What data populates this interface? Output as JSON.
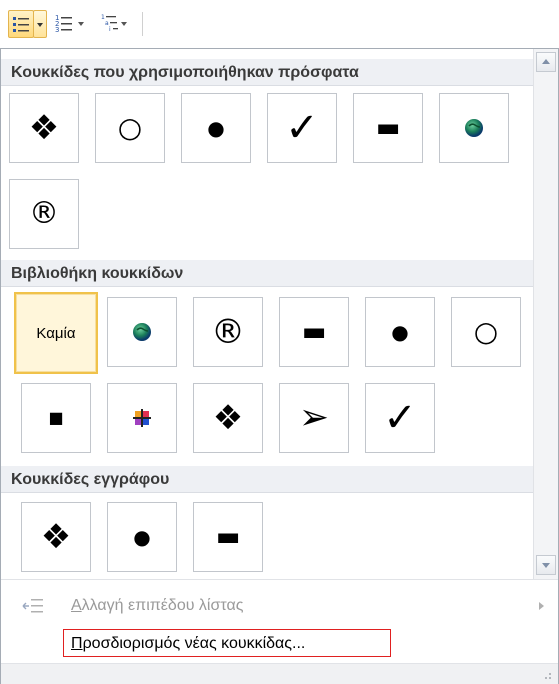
{
  "toolbar": {
    "bullets_icon": "bullet-list-icon",
    "numbering_icon": "numbered-list-icon",
    "multilevel_icon": "multilevel-list-icon",
    "dropdown_icon": "chevron-down-icon"
  },
  "sections": {
    "recent_title": "Κουκκίδες που χρησιμοποιήθηκαν πρόσφατα",
    "library_title": "Βιβλιοθήκη κουκκίδων",
    "document_title": "Κουκκίδες εγγράφου"
  },
  "recent_bullets": [
    "❖",
    "○",
    "●",
    "✓",
    "▬",
    "globe",
    "®"
  ],
  "library_bullets": [
    "Καμία",
    "globe",
    "®",
    "▬",
    "●",
    "○",
    "■",
    "multicolor-square",
    "❖",
    "➢",
    "✓"
  ],
  "document_bullets": [
    "❖",
    "●",
    "▬"
  ],
  "menu": {
    "change_level": "Αλλαγή επιπέδου λίστας",
    "define_new": "Προσδιορισμός νέας κουκκίδας..."
  },
  "colors": {
    "selected_border": "#f0c24a",
    "header_bg": "#eef0f4",
    "highlight_box": "#e02020"
  }
}
